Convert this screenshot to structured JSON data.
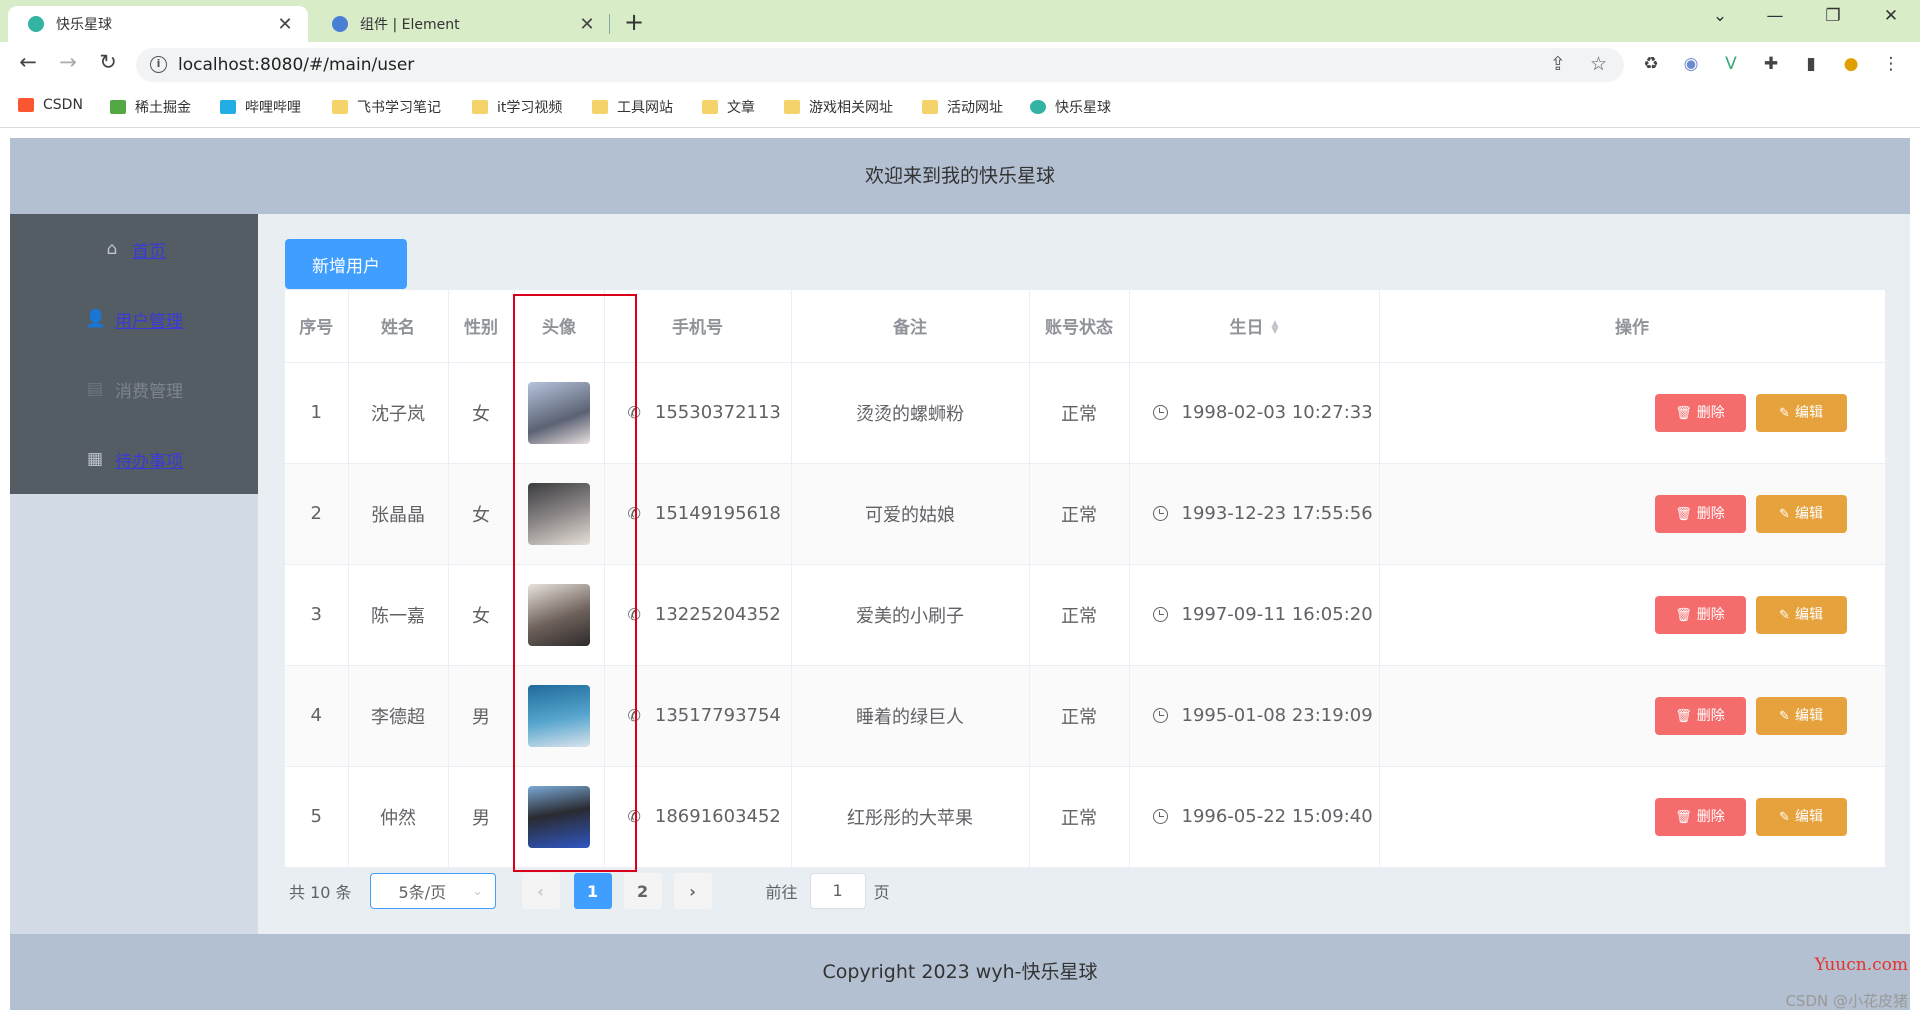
{
  "browser": {
    "tabs": [
      {
        "title": "快乐星球",
        "favicon_color": "#33b3a3"
      },
      {
        "title": "组件 | Element",
        "favicon_color": "#4a7fd6"
      }
    ],
    "url": "localhost:8080/#/main/user",
    "bookmarks": [
      {
        "label": "CSDN",
        "icon": "csdn-icon",
        "color": "#fc5531"
      },
      {
        "label": "稀土掘金",
        "icon": "juejin-icon",
        "color": "#52a843"
      },
      {
        "label": "哔哩哔哩",
        "icon": "bilibili-icon",
        "color": "#23ade5"
      },
      {
        "label": "飞书学习笔记",
        "icon": "folder-icon"
      },
      {
        "label": "it学习视频",
        "icon": "folder-icon"
      },
      {
        "label": "工具网站",
        "icon": "folder-icon"
      },
      {
        "label": "文章",
        "icon": "folder-icon"
      },
      {
        "label": "游戏相关网址",
        "icon": "folder-icon"
      },
      {
        "label": "活动网址",
        "icon": "folder-icon"
      },
      {
        "label": "快乐星球",
        "icon": "planet-icon",
        "color": "#33b3a3"
      }
    ]
  },
  "app": {
    "header_title": "欢迎来到我的快乐星球",
    "footer_text": "Copyright 2023 wyh-快乐星球",
    "menu": [
      {
        "label": "首页",
        "icon": "home-icon",
        "enabled": true
      },
      {
        "label": "用户管理",
        "icon": "user-icon",
        "enabled": true,
        "active": true
      },
      {
        "label": "消费管理",
        "icon": "document-icon",
        "enabled": false
      },
      {
        "label": "待办事项",
        "icon": "grid-icon",
        "enabled": true
      }
    ],
    "add_user_label": "新增用户",
    "table": {
      "columns": [
        "序号",
        "姓名",
        "性别",
        "头像",
        "手机号",
        "备注",
        "账号状态",
        "生日",
        "操作"
      ],
      "rows": [
        {
          "no": "1",
          "name": "沈子岚",
          "gender": "女",
          "avatar_color": "#8a97b4",
          "phone": "15530372113",
          "remark": "烫烫的螺蛳粉",
          "status": "正常",
          "birthday": "1998-02-03 10:27:33"
        },
        {
          "no": "2",
          "name": "张晶晶",
          "gender": "女",
          "avatar_color": "#5e5b60",
          "phone": "15149195618",
          "remark": "可爱的姑娘",
          "status": "正常",
          "birthday": "1993-12-23 17:55:56"
        },
        {
          "no": "3",
          "name": "陈一嘉",
          "gender": "女",
          "avatar_color": "#8c7f79",
          "phone": "13225204352",
          "remark": "爱美的小刷子",
          "status": "正常",
          "birthday": "1997-09-11 16:05:20"
        },
        {
          "no": "4",
          "name": "李德超",
          "gender": "男",
          "avatar_color": "#2f7fb0",
          "phone": "13517793754",
          "remark": "睡着的绿巨人",
          "status": "正常",
          "birthday": "1995-01-08 23:19:09"
        },
        {
          "no": "5",
          "name": "仲然",
          "gender": "男",
          "avatar_color": "#3c62b8",
          "phone": "18691603452",
          "remark": "红彤彤的大苹果",
          "status": "正常",
          "birthday": "1996-05-22 15:09:40"
        }
      ],
      "delete_label": "删除",
      "edit_label": "编辑"
    },
    "pagination": {
      "total_text": "共 10 条",
      "page_size": "5条/页",
      "pages": [
        "1",
        "2"
      ],
      "current_page": "1",
      "goto_prefix": "前往",
      "goto_value": "1",
      "goto_suffix": "页"
    }
  },
  "watermarks": {
    "site": "Yuucn.com",
    "author": "CSDN @小花皮猪"
  },
  "colors": {
    "primary": "#409eff",
    "danger": "#f56c6c",
    "warning": "#e6a23c",
    "success": "#67c23a",
    "aside_bg": "#545c64",
    "header_bg": "#b3c0d1",
    "highlight_border": "#d9001b"
  }
}
